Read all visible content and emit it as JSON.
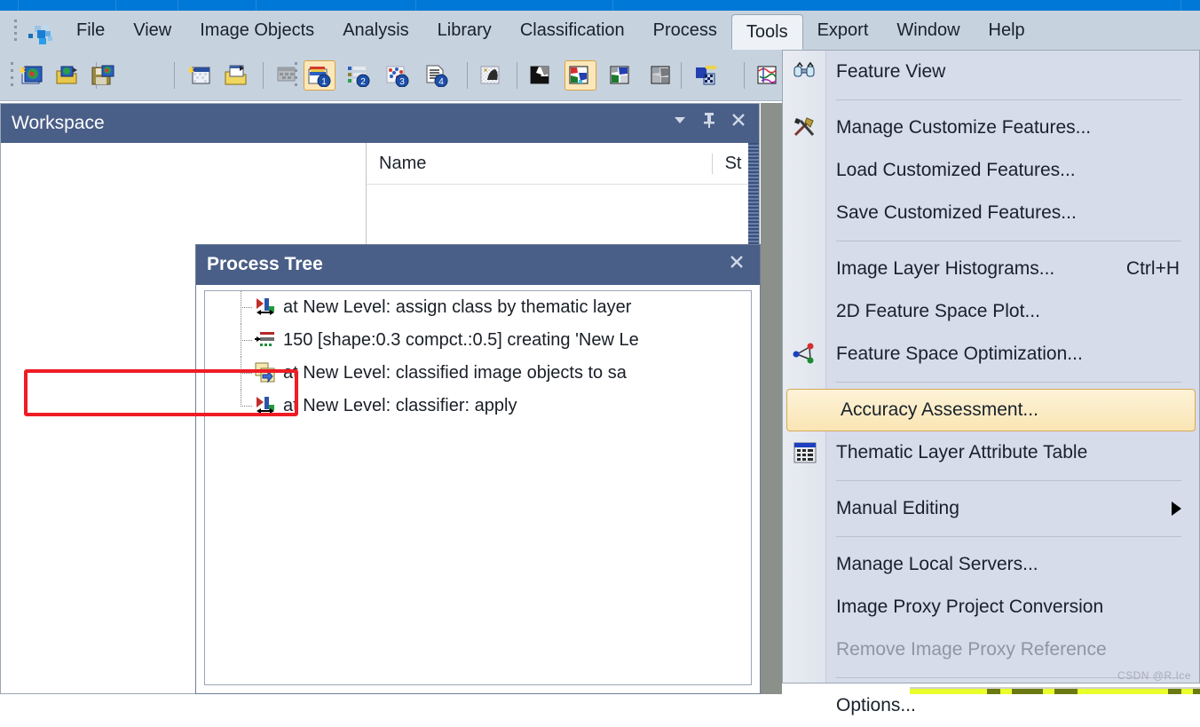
{
  "app": {
    "logo_icon": "ecognition-logo-icon",
    "watermark": "CSDN @R.Ice"
  },
  "menubar": {
    "items": [
      {
        "label": "File",
        "active": false
      },
      {
        "label": "View",
        "active": false
      },
      {
        "label": "Image Objects",
        "active": false
      },
      {
        "label": "Analysis",
        "active": false
      },
      {
        "label": "Library",
        "active": false
      },
      {
        "label": "Classification",
        "active": false
      },
      {
        "label": "Process",
        "active": false
      },
      {
        "label": "Tools",
        "active": true
      },
      {
        "label": "Export",
        "active": false
      },
      {
        "label": "Window",
        "active": false
      },
      {
        "label": "Help",
        "active": false
      }
    ]
  },
  "toolbar": {
    "buttons": [
      {
        "name": "new-project-icon",
        "selected": false
      },
      {
        "name": "open-project-icon",
        "selected": false
      },
      {
        "name": "save-project-icon",
        "selected": false
      },
      {
        "name": "new-workspace-icon",
        "selected": false
      },
      {
        "name": "open-workspace-icon",
        "selected": false
      },
      {
        "name": "create-copy-icon",
        "selected": false
      },
      {
        "name": "load-image-view-1-icon",
        "selected": true
      },
      {
        "name": "load-image-view-2-icon",
        "selected": false
      },
      {
        "name": "load-image-view-3-icon",
        "selected": false
      },
      {
        "name": "load-image-view-4-icon",
        "selected": false
      },
      {
        "name": "pixel-view-icon",
        "selected": false
      },
      {
        "name": "view-layer-icon",
        "selected": false
      },
      {
        "name": "view-classification-icon",
        "selected": true
      },
      {
        "name": "view-samples-icon",
        "selected": false
      },
      {
        "name": "view-grey-icon",
        "selected": false
      },
      {
        "name": "transparency-icon",
        "selected": false
      },
      {
        "name": "outline-view-icon",
        "selected": false
      }
    ]
  },
  "workspace": {
    "title": "Workspace",
    "dropdown_icon": "chevron-down-icon",
    "pin_icon": "pin-icon",
    "close_icon": "close-icon",
    "columns": [
      "Name",
      "St"
    ]
  },
  "process_tree": {
    "title": "Process Tree",
    "close_icon": "close-icon",
    "rows": [
      {
        "icon": "execute-process-icon",
        "text": "at  New Level: assign class by thematic layer"
      },
      {
        "icon": "segmentation-process-icon",
        "text": "150 [shape:0.3 compct.:0.5] creating 'New Le"
      },
      {
        "icon": "copy-objects-process-icon",
        "text": "at  New Level: classified image objects to sa"
      },
      {
        "icon": "execute-process-icon",
        "text": "at  New Level: classifier: apply"
      }
    ]
  },
  "tools_menu": {
    "entries": [
      {
        "type": "item",
        "label": "Feature View",
        "icon": "binoculars-icon",
        "accel": "",
        "disabled": false,
        "highlighted": false,
        "submenu": false
      },
      {
        "type": "separator"
      },
      {
        "type": "item",
        "label": "Manage Customize Features...",
        "icon": "hammer-wrench-icon",
        "accel": "",
        "disabled": false,
        "highlighted": false,
        "submenu": false
      },
      {
        "type": "item",
        "label": "Load Customized Features...",
        "icon": "",
        "accel": "",
        "disabled": false,
        "highlighted": false,
        "submenu": false
      },
      {
        "type": "item",
        "label": "Save Customized Features...",
        "icon": "",
        "accel": "",
        "disabled": false,
        "highlighted": false,
        "submenu": false
      },
      {
        "type": "separator"
      },
      {
        "type": "item",
        "label": "Image Layer Histograms...",
        "icon": "",
        "accel": "Ctrl+H",
        "disabled": false,
        "highlighted": false,
        "submenu": false
      },
      {
        "type": "item",
        "label": "2D Feature Space Plot...",
        "icon": "",
        "accel": "",
        "disabled": false,
        "highlighted": false,
        "submenu": false
      },
      {
        "type": "item",
        "label": "Feature Space Optimization...",
        "icon": "feature-space-graph-icon",
        "accel": "",
        "disabled": false,
        "highlighted": false,
        "submenu": false
      },
      {
        "type": "separator"
      },
      {
        "type": "item",
        "label": "Accuracy Assessment...",
        "icon": "",
        "accel": "",
        "disabled": false,
        "highlighted": true,
        "submenu": false
      },
      {
        "type": "item",
        "label": "Thematic Layer Attribute Table",
        "icon": "table-grid-icon",
        "accel": "",
        "disabled": false,
        "highlighted": false,
        "submenu": false
      },
      {
        "type": "separator"
      },
      {
        "type": "item",
        "label": "Manual Editing",
        "icon": "",
        "accel": "",
        "disabled": false,
        "highlighted": false,
        "submenu": true
      },
      {
        "type": "separator"
      },
      {
        "type": "item",
        "label": "Manage Local Servers...",
        "icon": "",
        "accel": "",
        "disabled": false,
        "highlighted": false,
        "submenu": false
      },
      {
        "type": "item",
        "label": "Image Proxy Project Conversion",
        "icon": "",
        "accel": "",
        "disabled": false,
        "highlighted": false,
        "submenu": false
      },
      {
        "type": "item",
        "label": "Remove Image Proxy Reference",
        "icon": "",
        "accel": "",
        "disabled": true,
        "highlighted": false,
        "submenu": false
      },
      {
        "type": "separator"
      },
      {
        "type": "item",
        "label": "Options...",
        "icon": "",
        "accel": "",
        "disabled": false,
        "highlighted": false,
        "submenu": false
      }
    ]
  },
  "annotation": {
    "highlight_color": "#ee1c25",
    "target_label": "Accuracy Assessment..."
  },
  "colors": {
    "titlebar_blue": "#0078d7",
    "chrome": "#c6d2de",
    "panel_header": "#4a5f87",
    "menu_bg": "#d6dcea",
    "menu_highlight": "#fae5b4"
  }
}
